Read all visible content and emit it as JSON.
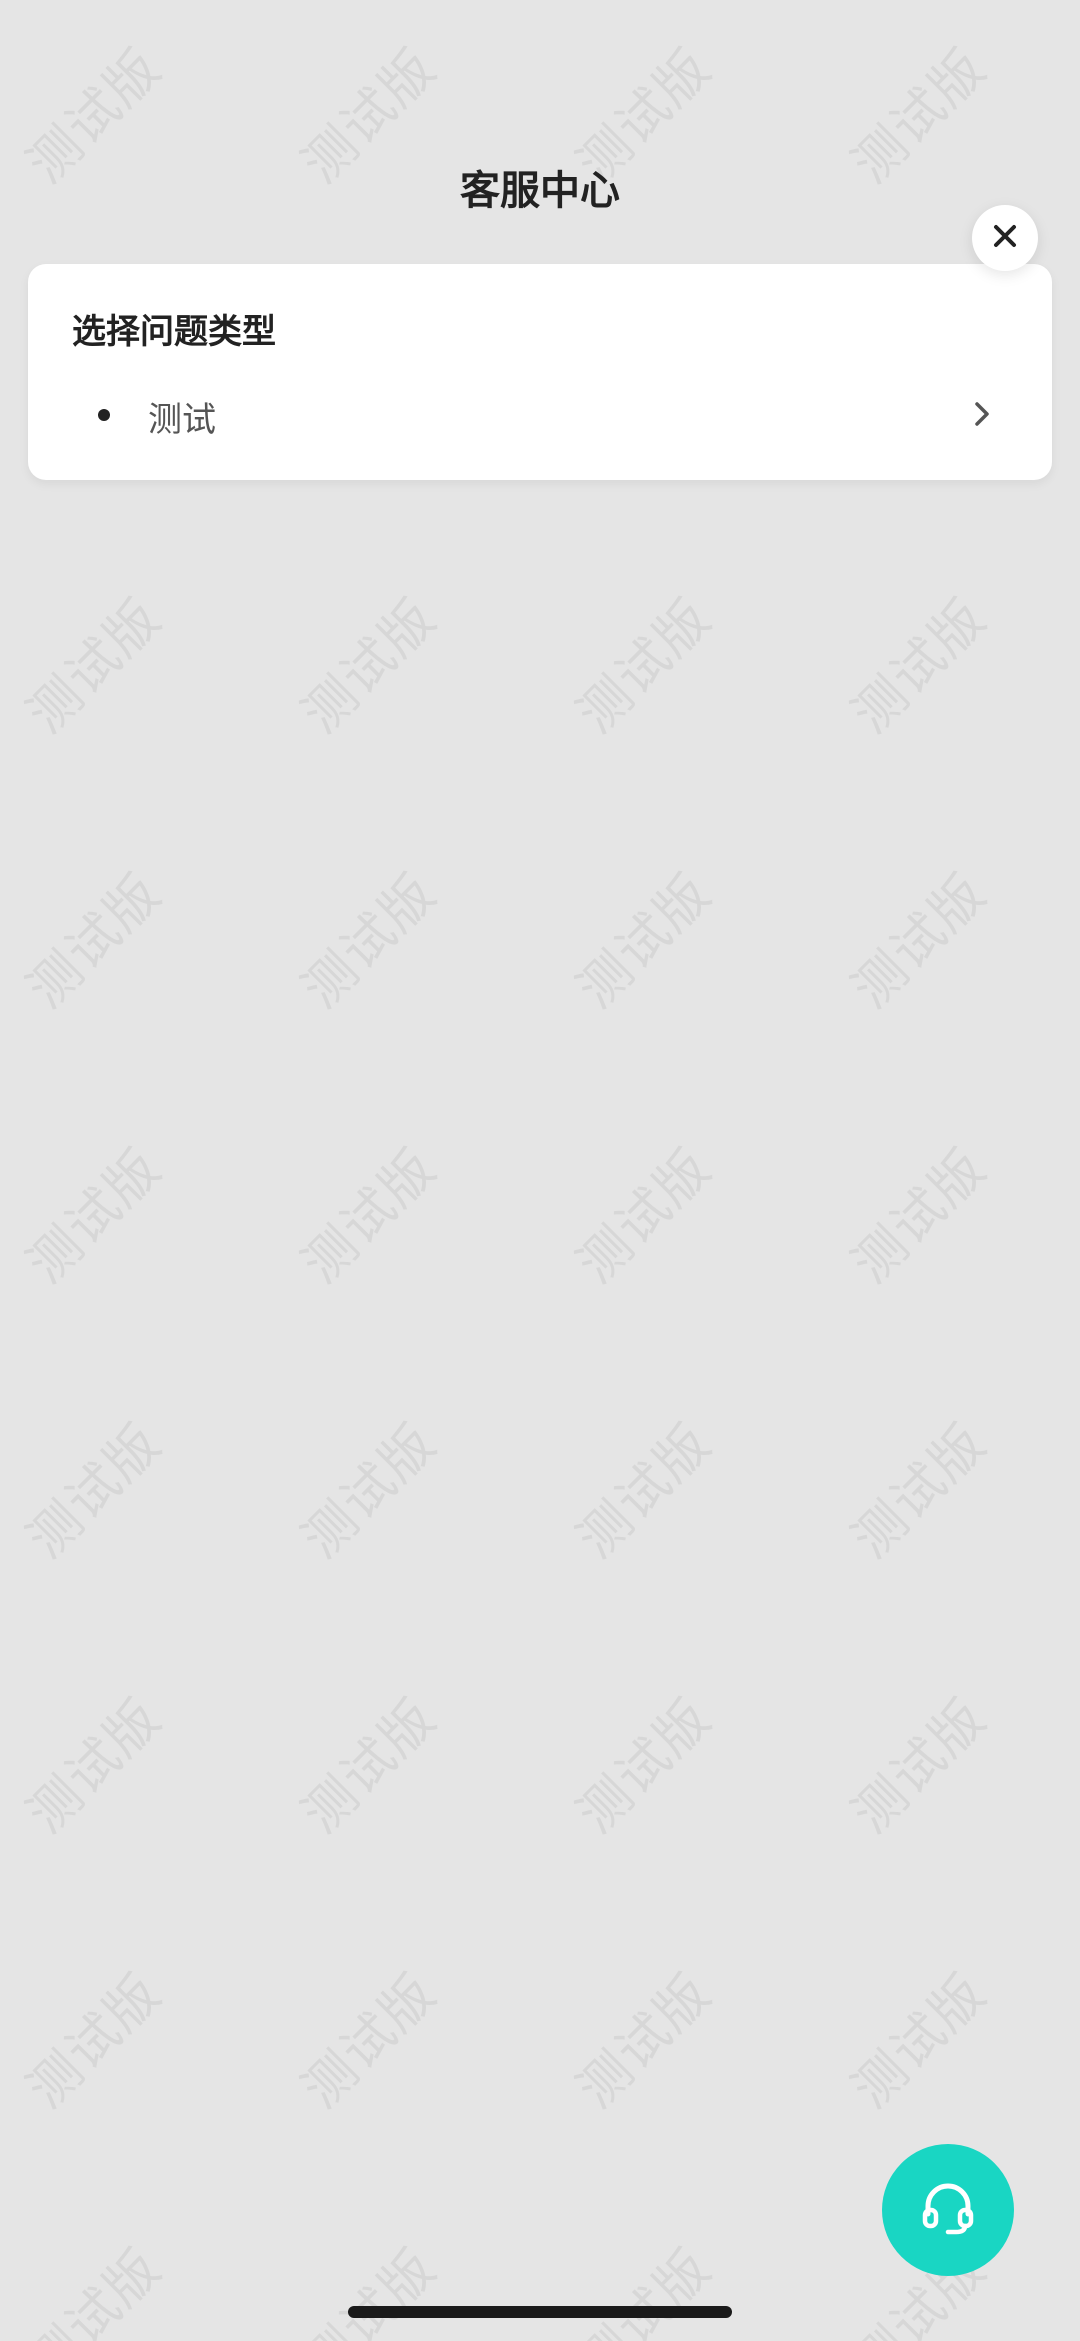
{
  "header": {
    "title": "客服中心"
  },
  "close_button": {
    "icon": "close-icon"
  },
  "question_card": {
    "title": "选择问题类型",
    "items": [
      {
        "label": "测试",
        "icon": "chevron-right-icon"
      }
    ]
  },
  "support_button": {
    "icon": "headset-icon",
    "color": "#19d6c3"
  },
  "watermark": {
    "text": "测试版"
  }
}
